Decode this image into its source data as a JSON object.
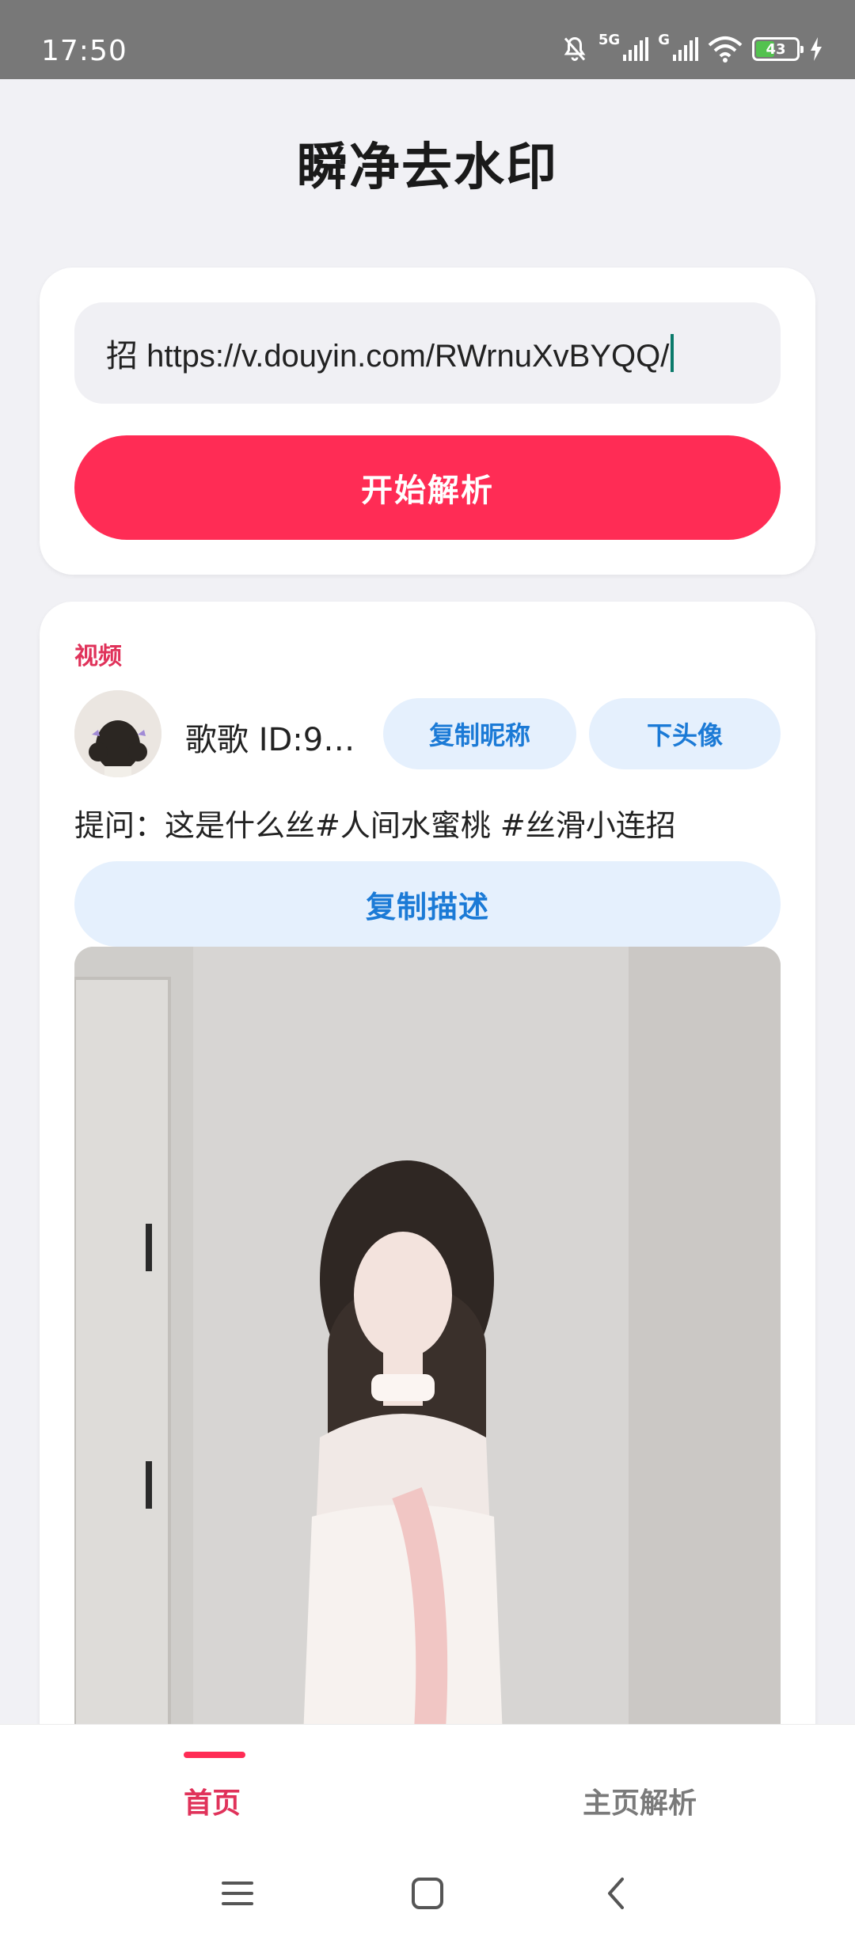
{
  "status_bar": {
    "time": "17:50",
    "network_1": "5G",
    "network_2": "G",
    "battery": "43",
    "battery_level": 0.43,
    "icons": [
      "bell-off-icon",
      "signal-icon",
      "signal-icon",
      "wifi-icon",
      "battery-icon",
      "charging-icon"
    ]
  },
  "page": {
    "title": "瞬净去水印"
  },
  "input": {
    "value": "招  https://v.douyin.com/RWrnuXvBYQQ/"
  },
  "parse_button": {
    "label": "开始解析"
  },
  "result": {
    "type_label": "视频",
    "author": "歌歌  ID:9…",
    "copy_nickname_label": "复制昵称",
    "download_avatar_label": "下头像",
    "description": "提问：这是什么丝#人间水蜜桃 #丝滑小连招",
    "copy_description_label": "复制描述"
  },
  "bottom_nav": {
    "tabs": [
      {
        "label": "首页",
        "active": true
      },
      {
        "label": "主页解析",
        "active": false
      }
    ]
  },
  "colors": {
    "accent": "#ff2c55",
    "accent_text": "#e0325a",
    "secondary_bg": "#e5f0fd",
    "secondary_text": "#1b7ad6",
    "page_bg": "#f1f1f5"
  }
}
